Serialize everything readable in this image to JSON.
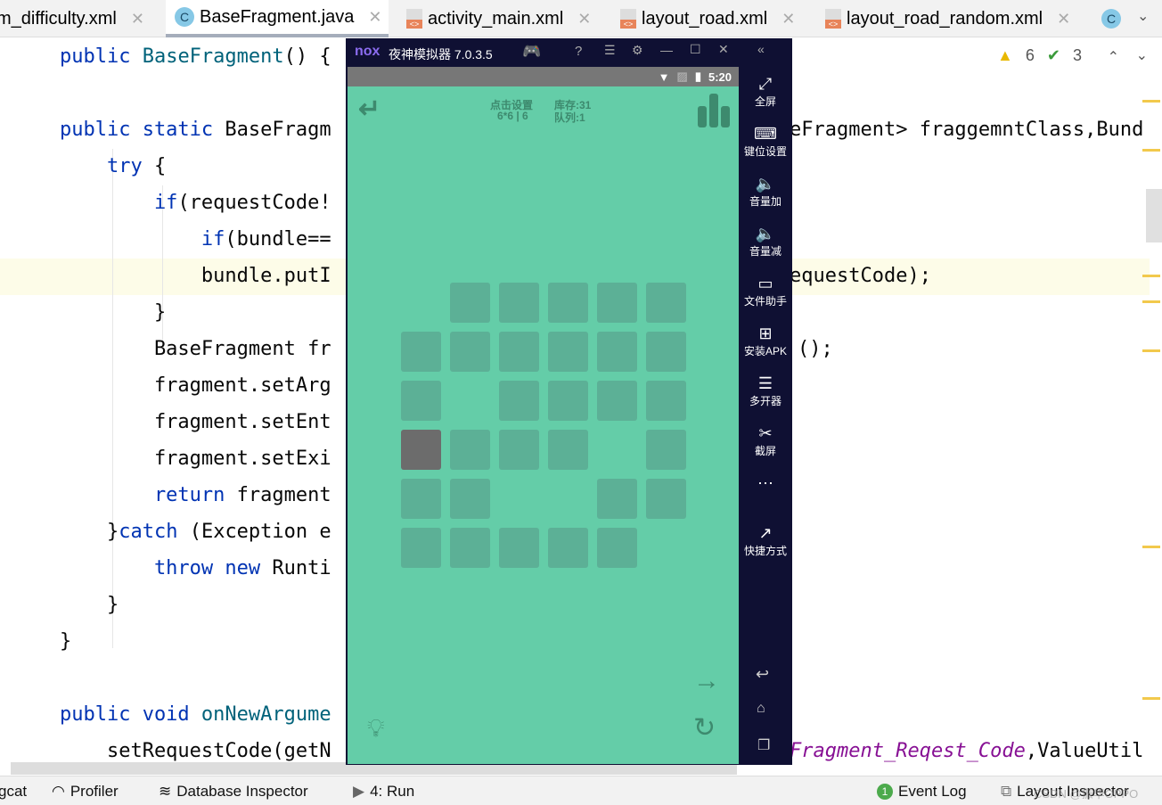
{
  "tabs": [
    {
      "label": "m_difficulty.xml",
      "icon": "xml-file-icon"
    },
    {
      "label": "BaseFragment.java",
      "icon": "java-class-icon",
      "active": true
    },
    {
      "label": "activity_main.xml",
      "icon": "xml-file-icon"
    },
    {
      "label": "layout_road.xml",
      "icon": "xml-file-icon"
    },
    {
      "label": "layout_road_random.xml",
      "icon": "xml-file-icon"
    }
  ],
  "tab_overflow": "C",
  "inspections": {
    "warnings": "6",
    "weak_warnings": "3"
  },
  "code": [
    {
      "left": [
        [
          "    public ",
          "kw"
        ],
        [
          "BaseFragment",
          "fn"
        ],
        [
          "() {",
          ""
        ]
      ],
      "right": []
    },
    {
      "left": [],
      "right": []
    },
    {
      "left": [
        [
          "    public static ",
          "kw"
        ],
        [
          "BaseFragm",
          ""
        ]
      ],
      "right": [
        [
          "eFragment> fraggemntClass,Bund",
          ""
        ]
      ]
    },
    {
      "left": [
        [
          "        try ",
          "kw"
        ],
        [
          "{",
          ""
        ]
      ],
      "right": []
    },
    {
      "left": [
        [
          "            if",
          "kw"
        ],
        [
          "(requestCode!",
          ""
        ]
      ],
      "right": []
    },
    {
      "left": [
        [
          "                if",
          "kw"
        ],
        [
          "(bundle==",
          ""
        ]
      ],
      "right": []
    },
    {
      "left": [
        [
          "                bundle.putI",
          ""
        ]
      ],
      "right": [
        [
          "equestCode);",
          ""
        ]
      ]
    },
    {
      "left": [
        [
          "            }",
          ""
        ]
      ],
      "right": []
    },
    {
      "left": [
        [
          "            BaseFragment fr",
          ""
        ]
      ],
      "right": [
        [
          "();",
          ""
        ]
      ]
    },
    {
      "left": [
        [
          "            fragment.setArg",
          ""
        ]
      ],
      "right": []
    },
    {
      "left": [
        [
          "            fragment.setEnt",
          ""
        ]
      ],
      "right": []
    },
    {
      "left": [
        [
          "            fragment.setExi",
          ""
        ]
      ],
      "right": []
    },
    {
      "left": [
        [
          "            return ",
          "kw"
        ],
        [
          "fragment",
          ""
        ]
      ],
      "right": []
    },
    {
      "left": [
        [
          "        }",
          ""
        ],
        [
          "catch ",
          "kw"
        ],
        [
          "(Exception e",
          ""
        ]
      ],
      "right": []
    },
    {
      "left": [
        [
          "            throw new ",
          "kw"
        ],
        [
          "Runti",
          ""
        ]
      ],
      "right": []
    },
    {
      "left": [
        [
          "        }",
          ""
        ]
      ],
      "right": []
    },
    {
      "left": [
        [
          "    }",
          ""
        ]
      ],
      "right": []
    },
    {
      "left": [],
      "right": []
    },
    {
      "left": [
        [
          "    public void ",
          "kw"
        ],
        [
          "onNewArgume",
          "fn"
        ]
      ],
      "right": []
    },
    {
      "left": [
        [
          "        setRequestCode(getN",
          ""
        ]
      ],
      "right": [
        [
          "Fragment_Reqest_Code",
          "st"
        ],
        [
          ",ValueUtil",
          ""
        ]
      ]
    }
  ],
  "emulator": {
    "title": "夜神模拟器 7.0.3.5",
    "logo": "nox",
    "time": "5:20",
    "header": {
      "line1a": "点击设置",
      "line1b": "6*6 | 6",
      "line2a": "库存:31",
      "line2b": "队列:1"
    },
    "grid": [
      [
        0,
        1,
        1,
        1,
        1,
        1
      ],
      [
        1,
        1,
        1,
        1,
        1,
        1
      ],
      [
        1,
        0,
        1,
        1,
        1,
        1
      ],
      [
        2,
        1,
        1,
        1,
        0,
        1
      ],
      [
        1,
        1,
        0,
        0,
        1,
        1
      ],
      [
        1,
        1,
        1,
        1,
        1,
        0
      ]
    ],
    "colors": {
      "bg": "#64cda8",
      "cell": "#5cb096",
      "selected": "#6c6c6c"
    },
    "sidebar": [
      {
        "icon": "fullscreen-icon",
        "glyph": "⤢",
        "label": "全屏"
      },
      {
        "icon": "keyboard-icon",
        "glyph": "⌨",
        "label": "键位设置"
      },
      {
        "icon": "volume-up-icon",
        "glyph": "🔈",
        "label": "音量加"
      },
      {
        "icon": "volume-down-icon",
        "glyph": "🔈",
        "label": "音量减"
      },
      {
        "icon": "file-helper-icon",
        "glyph": "▭",
        "label": "文件助手"
      },
      {
        "icon": "install-apk-icon",
        "glyph": "⊞",
        "label": "安装APK"
      },
      {
        "icon": "multi-instance-icon",
        "glyph": "☰",
        "label": "多开器"
      },
      {
        "icon": "screenshot-icon",
        "glyph": "✂",
        "label": "截屏"
      },
      {
        "icon": "more-icon",
        "glyph": "⋯",
        "label": ""
      },
      {
        "icon": "shortcut-icon",
        "glyph": "↗",
        "label": "快捷方式"
      }
    ]
  },
  "statusbar": {
    "logcat": "gcat",
    "profiler": "Profiler",
    "db": "Database Inspector",
    "run": "4: Run",
    "event_count": "1",
    "event_log": "Event Log",
    "layout_inspector": "Layout Inspector",
    "watermark": "CSDN @振华OPPO"
  }
}
